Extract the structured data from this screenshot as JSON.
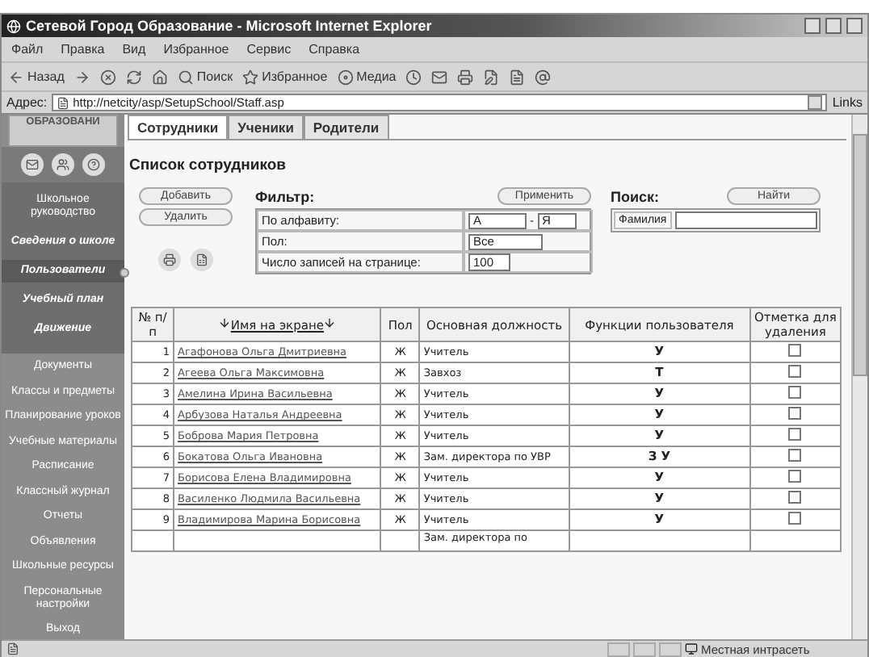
{
  "window": {
    "title": "Сетевой Город Образование - Microsoft Internet Explorer"
  },
  "menu": [
    "Файл",
    "Правка",
    "Вид",
    "Избранное",
    "Сервис",
    "Справка"
  ],
  "toolbar": [
    {
      "kind": "back",
      "label": "Назад"
    },
    {
      "kind": "forward"
    },
    {
      "kind": "stop"
    },
    {
      "kind": "refresh"
    },
    {
      "kind": "home"
    },
    {
      "kind": "search",
      "label": "Поиск"
    },
    {
      "kind": "favorites",
      "label": "Избранное"
    },
    {
      "kind": "media",
      "label": "Медиа"
    },
    {
      "kind": "history"
    },
    {
      "kind": "mail"
    },
    {
      "kind": "print"
    },
    {
      "kind": "edit"
    },
    {
      "kind": "discuss"
    },
    {
      "kind": "messenger"
    }
  ],
  "address": {
    "label": "Адрес:",
    "url": "http://netcity/asp/SetupSchool/Staff.asp",
    "links": "Links"
  },
  "sidebar": {
    "logo": "ОБРАЗОВАНИ",
    "upper": [
      {
        "label": "Школьное руководство",
        "kind": "plain",
        "selected": false
      },
      {
        "label": "Сведения о школе",
        "kind": "emphasis",
        "selected": false
      },
      {
        "label": "Пользователи",
        "kind": "emphasis",
        "selected": true
      },
      {
        "label": "Учебный план",
        "kind": "emphasis",
        "selected": false
      },
      {
        "label": "Движение",
        "kind": "emphasis",
        "selected": false
      }
    ],
    "lower": [
      "Документы",
      "Классы и предметы",
      "Планирование уроков",
      "Учебные материалы",
      "Расписание",
      "Классный журнал",
      "Отчеты",
      "Объявления",
      "Школьные ресурсы",
      "Персональные настройки",
      "Выход"
    ]
  },
  "tabs": [
    {
      "label": "Сотрудники",
      "selected": true
    },
    {
      "label": "Ученики",
      "selected": false
    },
    {
      "label": "Родители",
      "selected": false
    }
  ],
  "heading": "Список сотрудников",
  "actions": [
    "Добавить",
    "Удалить"
  ],
  "filter": {
    "title": "Фильтр:",
    "apply": "Применить",
    "alphabet_label": "По алфавиту:",
    "from": "А",
    "separator": "-",
    "to": "Я",
    "sex_label": "Пол:",
    "sex": "Все",
    "per_page_label": "Число записей на странице:",
    "per_page": "100"
  },
  "search": {
    "title": "Поиск:",
    "find": "Найти",
    "label": "Фамилия"
  },
  "table": {
    "columns": [
      "№ п/п",
      "Имя на экране",
      "Пол",
      "Основная должность",
      "Функции пользователя",
      "Отметка для удаления"
    ],
    "rows": [
      {
        "num": "1",
        "name": "Агафонова Ольга Дмитриевна",
        "sex": "Ж",
        "position": "Учитель",
        "functions": "У",
        "checked": false
      },
      {
        "num": "2",
        "name": "Агеева Ольга Максимовна",
        "sex": "Ж",
        "position": "Завхоз",
        "functions": "Т",
        "checked": false
      },
      {
        "num": "3",
        "name": "Амелина Ирина Васильевна",
        "sex": "Ж",
        "position": "Учитель",
        "functions": "У",
        "checked": false
      },
      {
        "num": "4",
        "name": "Арбузова Наталья Андреевна",
        "sex": "Ж",
        "position": "Учитель",
        "functions": "У",
        "checked": false
      },
      {
        "num": "5",
        "name": "Боброва Мария Петровна",
        "sex": "Ж",
        "position": "Учитель",
        "functions": "У",
        "checked": false
      },
      {
        "num": "6",
        "name": "Бокатова Ольга Ивановна",
        "sex": "Ж",
        "position": "Зам. директора по УВР",
        "functions": "З У",
        "checked": false
      },
      {
        "num": "7",
        "name": "Борисова Елена Владимировна",
        "sex": "Ж",
        "position": "Учитель",
        "functions": "У",
        "checked": false
      },
      {
        "num": "8",
        "name": "Василенко Людмила Васильевна",
        "sex": "Ж",
        "position": "Учитель",
        "functions": "У",
        "checked": false
      },
      {
        "num": "9",
        "name": "Владимирова Марина Борисовна",
        "sex": "Ж",
        "position": "Учитель",
        "functions": "У",
        "checked": false
      },
      {
        "position": "Зам. директора по"
      }
    ]
  },
  "status_bar": {
    "zone": "Местная интрасеть"
  }
}
